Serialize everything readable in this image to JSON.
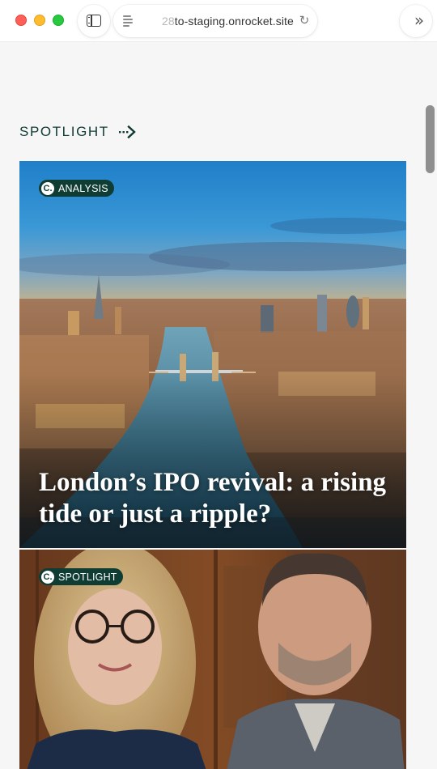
{
  "browser": {
    "window_controls": {
      "close": "close-window",
      "minimize": "minimize-window",
      "zoom": "zoom-window"
    },
    "sidebar_icon": "sidebar-icon",
    "reader_icon": "reader-icon",
    "url_prefix": "28",
    "url_main": "to-staging.onrocket.site",
    "reload_icon": "reload-icon",
    "forward_icon": "forward-icon",
    "reload_glyph": "↻",
    "forward_glyph": "»"
  },
  "section": {
    "title": "SPOTLIGHT",
    "arrow_icon": "dotted-arrow-icon"
  },
  "cards": [
    {
      "badge_logo": "C.",
      "badge": "ANALYSIS",
      "headline": "London’s IPO revival: a rising tide or just a ripple?"
    },
    {
      "badge_logo": "C.",
      "badge": "SPOTLIGHT"
    }
  ],
  "colors": {
    "brand_dark_green": "#0f3d34",
    "page_background": "#f6f6f6",
    "traffic_red": "#ff5f57",
    "traffic_yellow": "#febc2e",
    "traffic_green": "#28c840"
  }
}
